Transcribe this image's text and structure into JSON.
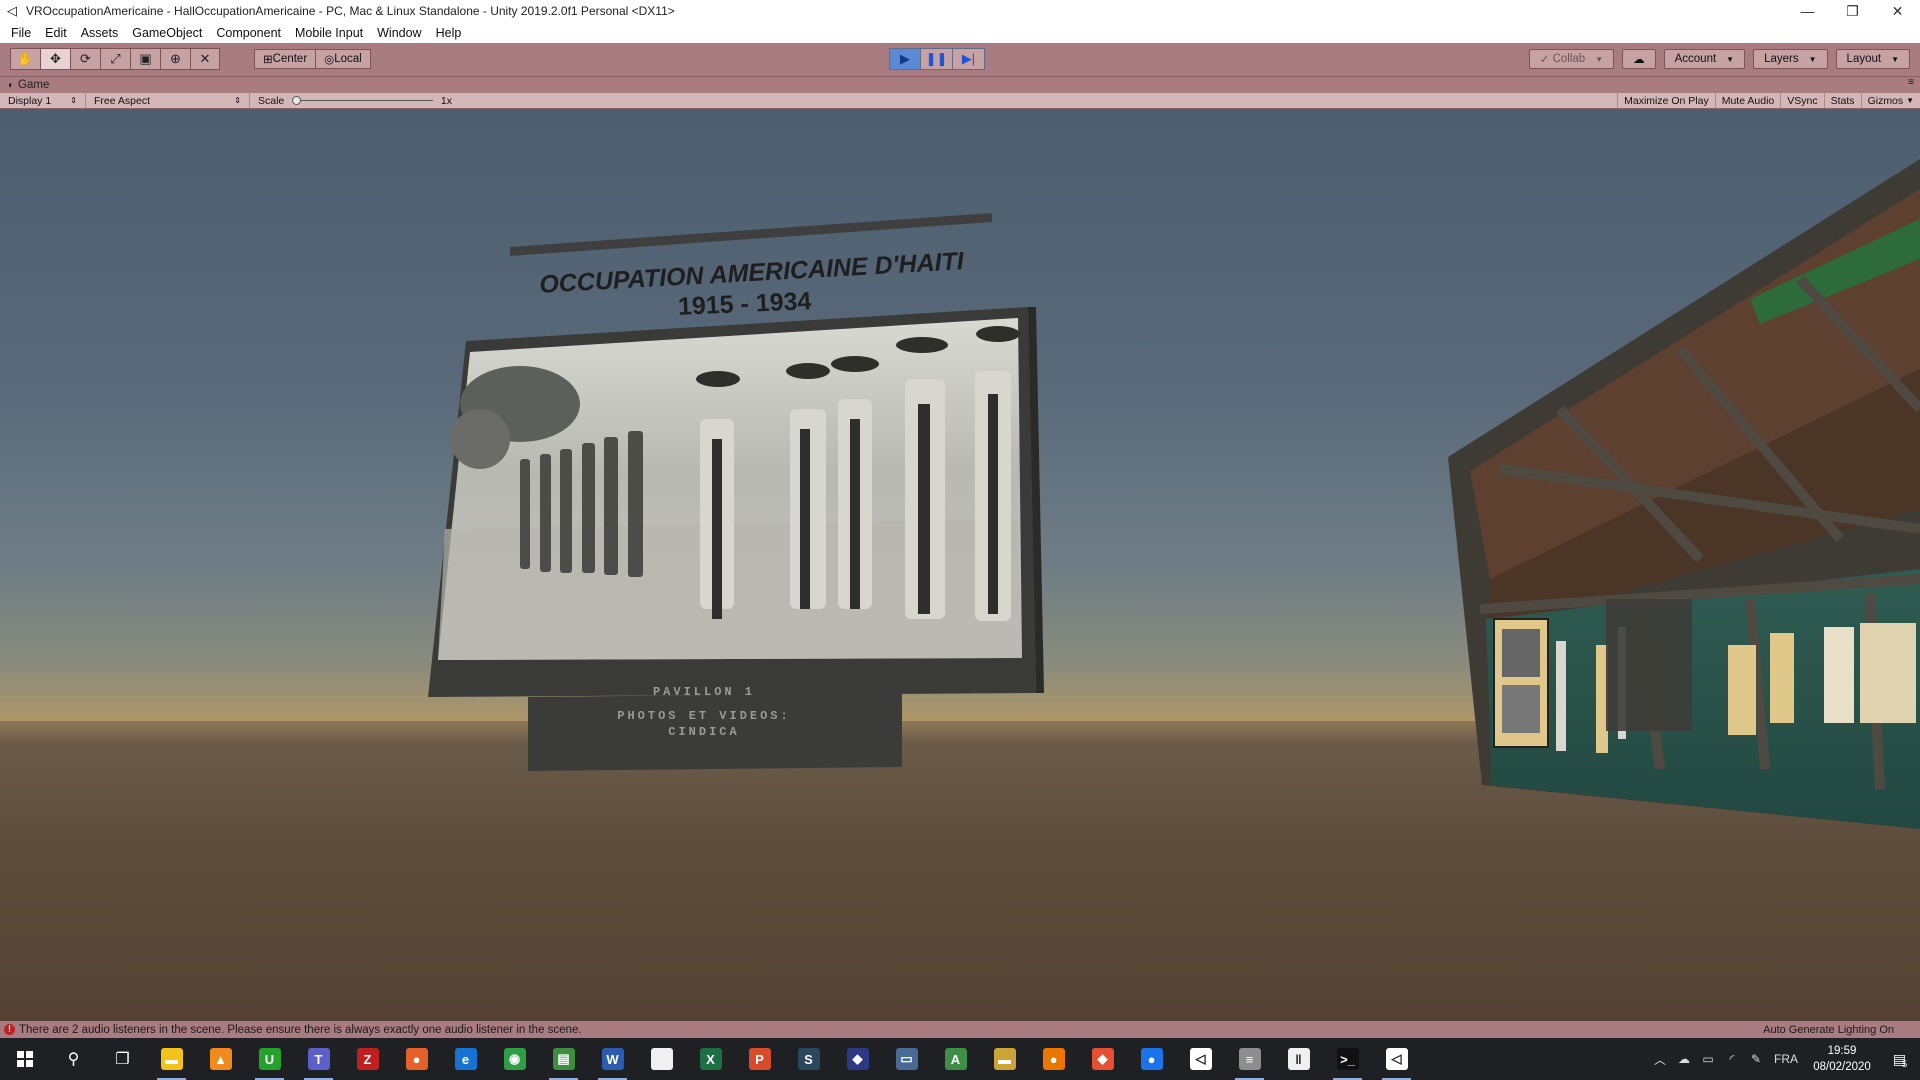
{
  "window": {
    "title": "VROccupationAmericaine - HallOccupationAmericaine - PC, Mac & Linux Standalone - Unity 2019.2.0f1 Personal <DX11>",
    "minimize": "—",
    "maximize": "❐",
    "close": "✕"
  },
  "menu": [
    "File",
    "Edit",
    "Assets",
    "GameObject",
    "Component",
    "Mobile Input",
    "Window",
    "Help"
  ],
  "toolbar": {
    "tools": [
      "hand-tool-icon",
      "move-tool-icon",
      "rotate-tool-icon",
      "scale-tool-icon",
      "rect-tool-icon",
      "transform-tool-icon",
      "custom-tool-icon"
    ],
    "pivot_mode": "Center",
    "pivot_rotation": "Local",
    "collab": "Collab",
    "account": "Account",
    "layers": "Layers",
    "layout": "Layout"
  },
  "game_view": {
    "tab": "Game",
    "display": "Display 1",
    "aspect": "Free Aspect",
    "scale_label": "Scale",
    "scale_value": "1x",
    "toggles": [
      "Maximize On Play",
      "Mute Audio",
      "VSync",
      "Stats",
      "Gizmos"
    ]
  },
  "scene": {
    "sign_title": "OCCUPATION AMERICAINE D'HAITI",
    "sign_years": "1915 - 1934",
    "plaque_line1": "PAVILLON 1",
    "plaque_line2": "PHOTOS ET VIDEOS:",
    "plaque_line3": "CINDICA"
  },
  "status": {
    "message": "There are 2 audio listeners in the scene. Please ensure there is always exactly one audio listener in the scene.",
    "lighting": "Auto Generate Lighting On"
  },
  "taskbar": {
    "apps": [
      {
        "name": "file-explorer-icon",
        "color": "#f3c21b",
        "glyph": "▬"
      },
      {
        "name": "vlc-icon",
        "color": "#f08a1c",
        "glyph": "▲"
      },
      {
        "name": "upwork-icon",
        "color": "#24a22c",
        "glyph": "U"
      },
      {
        "name": "teams-icon",
        "color": "#5b5fc7",
        "glyph": "T"
      },
      {
        "name": "filezilla-icon",
        "color": "#bf1f1f",
        "glyph": "Z"
      },
      {
        "name": "firefox-icon",
        "color": "#e4622a",
        "glyph": "●"
      },
      {
        "name": "edge-icon",
        "color": "#1673d4",
        "glyph": "e"
      },
      {
        "name": "chrome-icon",
        "color": "#2f9e44",
        "glyph": "◉"
      },
      {
        "name": "spreadsheet-icon",
        "color": "#3e8e3e",
        "glyph": "▤"
      },
      {
        "name": "word-icon",
        "color": "#2b5cb0",
        "glyph": "W"
      },
      {
        "name": "document-icon",
        "color": "#f0f0f0",
        "glyph": " "
      },
      {
        "name": "excel-icon",
        "color": "#1d7044",
        "glyph": "X"
      },
      {
        "name": "pdf-icon",
        "color": "#d74b2b",
        "glyph": "P"
      },
      {
        "name": "steam-icon",
        "color": "#2a475e",
        "glyph": "S"
      },
      {
        "name": "unity-hub-icon",
        "color": "#2b3a82",
        "glyph": "◆"
      },
      {
        "name": "monitor-icon",
        "color": "#4a6a96",
        "glyph": "▭"
      },
      {
        "name": "android-icon",
        "color": "#3e8e45",
        "glyph": "A"
      },
      {
        "name": "folder-icon",
        "color": "#caa436",
        "glyph": "▬"
      },
      {
        "name": "blender-icon",
        "color": "#ea7600",
        "glyph": "●"
      },
      {
        "name": "git-icon",
        "color": "#e84e31",
        "glyph": "◆"
      },
      {
        "name": "maps-icon",
        "color": "#1a73e8",
        "glyph": "●"
      },
      {
        "name": "unity-icon",
        "color": "#ffffff",
        "glyph": "◁"
      },
      {
        "name": "database-icon",
        "color": "#8d8d8d",
        "glyph": "≡"
      },
      {
        "name": "tool-icon",
        "color": "#f0f0f0",
        "glyph": "‖"
      },
      {
        "name": "terminal-icon",
        "color": "#111111",
        "glyph": ">_"
      },
      {
        "name": "unity-editor-icon",
        "color": "#ffffff",
        "glyph": "◁"
      }
    ],
    "language": "FRA",
    "time": "19:59",
    "date": "08/02/2020",
    "notifications": "5"
  }
}
